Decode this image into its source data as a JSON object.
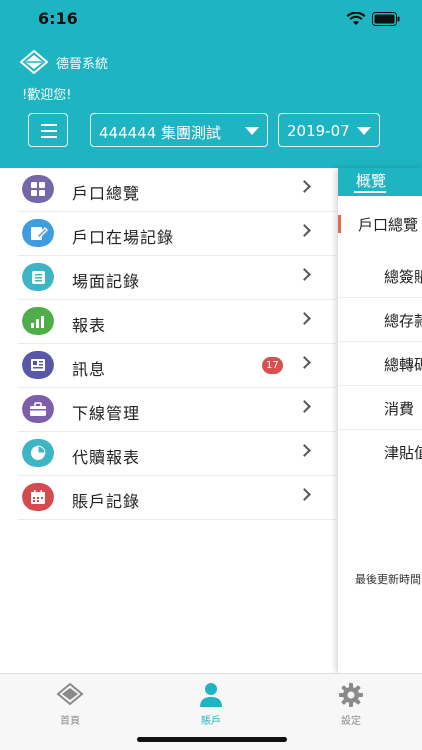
{
  "status_bar": {
    "time": "6:16"
  },
  "header": {
    "app_title": "德晉系統",
    "welcome": "!歡迎您!",
    "group_select": "444444 集團測試",
    "month_select": "2019-07"
  },
  "drawer": {
    "items": [
      {
        "label": "戶口總覽",
        "icon": "grid-icon",
        "color": "#7566a8"
      },
      {
        "label": "戶口在場記錄",
        "icon": "edit-icon",
        "color": "#3d9de0"
      },
      {
        "label": "場面記錄",
        "icon": "list-icon",
        "color": "#3eb5c4"
      },
      {
        "label": "報表",
        "icon": "bar-chart-icon",
        "color": "#4fae4a"
      },
      {
        "label": "訊息",
        "icon": "news-icon",
        "color": "#5857a8",
        "badge": "17"
      },
      {
        "label": "下線管理",
        "icon": "briefcase-icon",
        "color": "#7c5fa8"
      },
      {
        "label": "代贖報表",
        "icon": "pie-chart-icon",
        "color": "#3eb5c4"
      },
      {
        "label": "賬戶記錄",
        "icon": "calendar-icon",
        "color": "#d54a4e"
      }
    ]
  },
  "panel": {
    "tab": "概覽",
    "section_title": "戶口總覽",
    "rows": [
      "總簽賬",
      "總存款",
      "總轉碼",
      "消費",
      "津貼值"
    ],
    "updated": "最後更新時間"
  },
  "tabbar": {
    "items": [
      {
        "label": "首頁",
        "icon": "home-diamond-icon",
        "active": false
      },
      {
        "label": "賬戶",
        "icon": "user-icon",
        "active": true
      },
      {
        "label": "設定",
        "icon": "gear-icon",
        "active": false
      }
    ]
  },
  "colors": {
    "brand": "#1eb4c2",
    "badge": "#d8504f",
    "tab_inactive": "#8a8a8a"
  }
}
